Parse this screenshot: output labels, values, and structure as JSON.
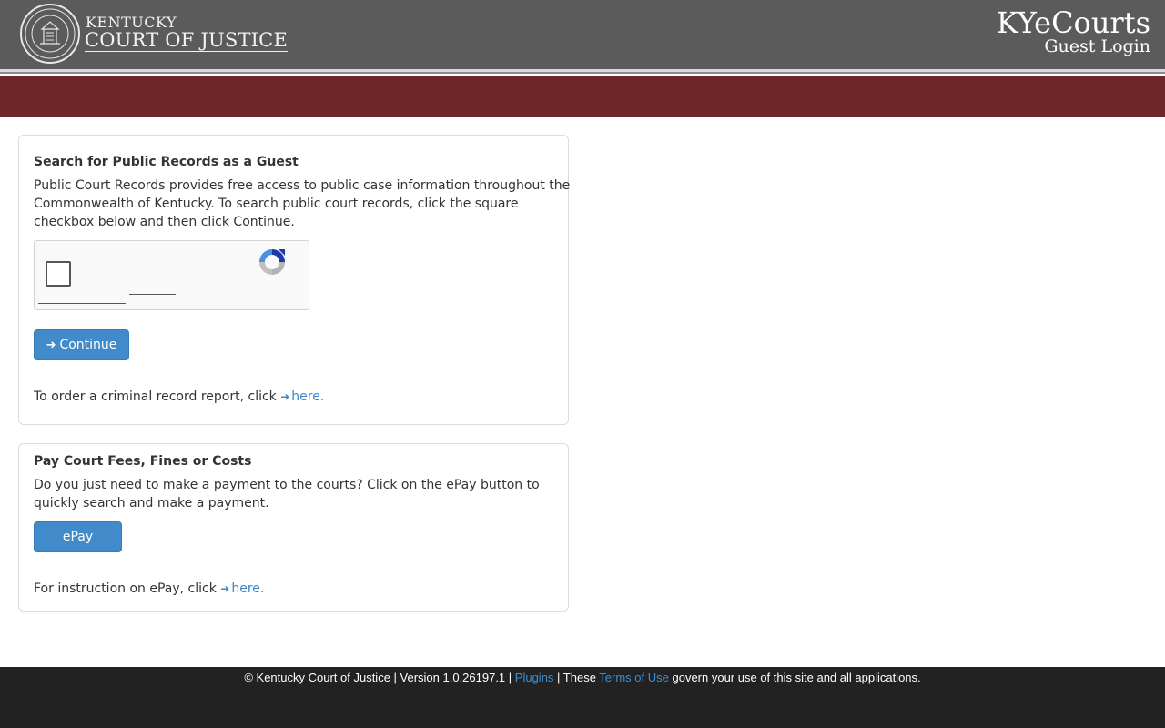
{
  "header": {
    "brand_top": "KENTUCKY",
    "brand_main": "COURT OF JUSTICE",
    "app_title": "KYeCourts",
    "app_subtitle": "Guest Login"
  },
  "public_records": {
    "title": "Search for Public Records as a Guest",
    "description": "Public Court Records provides free access to public case information throughout the Commonwealth of Kentucky. To search public court records, click the square checkbox below and then click Continue.",
    "continue_label": "Continue",
    "order_text": "To order a criminal record report, click ",
    "order_link": "here."
  },
  "payments": {
    "title": "Pay Court Fees, Fines or Costs",
    "description": "Do you just need to make a payment to the courts? Click on the ePay button to quickly search and make a payment.",
    "epay_label": "ePay",
    "instruction_text": "For instruction on ePay, click ",
    "instruction_link": "here."
  },
  "footer": {
    "copyright": "© Kentucky Court of Justice | Version 1.0.26197.1 | ",
    "plugins_link": "Plugins",
    "sep": " | These ",
    "terms_link": "Terms of Use",
    "tail": " govern your use of this site and all applications."
  },
  "colors": {
    "header_bg": "#5b5b5b",
    "accent_red": "#6e2628",
    "button_blue": "#428bca",
    "link_blue": "#3a87c7",
    "footer_bg": "#222222"
  },
  "icons": {
    "seal": "court-seal-icon",
    "login": "sign-in-icon",
    "recaptcha": "recaptcha-icon"
  }
}
